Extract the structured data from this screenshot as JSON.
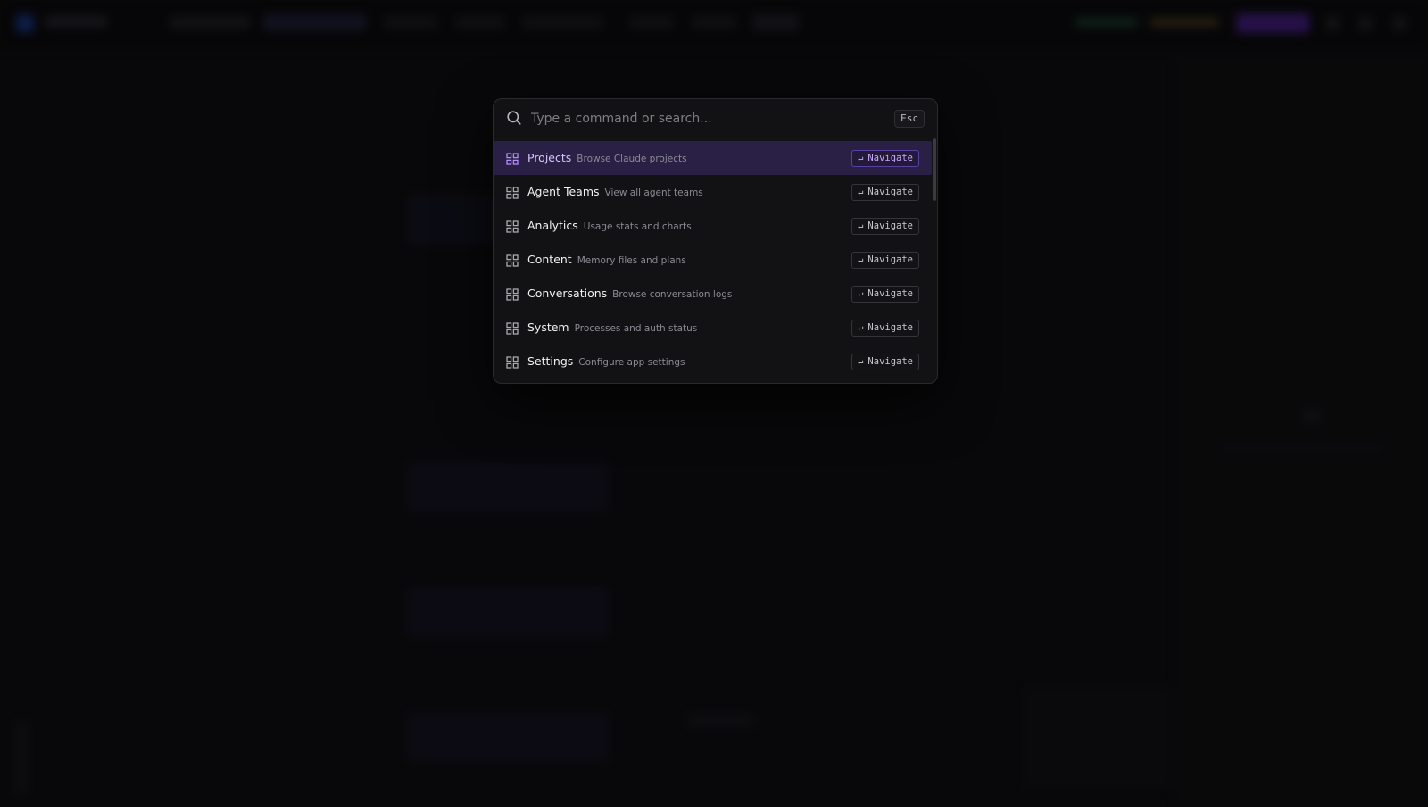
{
  "search": {
    "placeholder": "Type a command or search...",
    "value": "",
    "esc_label": "Esc"
  },
  "commands": [
    {
      "label": "Projects",
      "description": "Browse Claude projects",
      "action": "Navigate",
      "active": true
    },
    {
      "label": "Agent Teams",
      "description": "View all agent teams",
      "action": "Navigate",
      "active": false
    },
    {
      "label": "Analytics",
      "description": "Usage stats and charts",
      "action": "Navigate",
      "active": false
    },
    {
      "label": "Content",
      "description": "Memory files and plans",
      "action": "Navigate",
      "active": false
    },
    {
      "label": "Conversations",
      "description": "Browse conversation logs",
      "action": "Navigate",
      "active": false
    },
    {
      "label": "System",
      "description": "Processes and auth status",
      "action": "Navigate",
      "active": false
    },
    {
      "label": "Settings",
      "description": "Configure app settings",
      "action": "Navigate",
      "active": false
    }
  ],
  "icons": {
    "search": "search-icon",
    "item": "grid-icon",
    "enter_glyph": "↵"
  },
  "colors": {
    "accent": "#7c3aed",
    "active_row": "#2a1f44",
    "active_text": "#d8c4ff",
    "background": "#0a0a0b",
    "palette_bg": "#121214"
  }
}
